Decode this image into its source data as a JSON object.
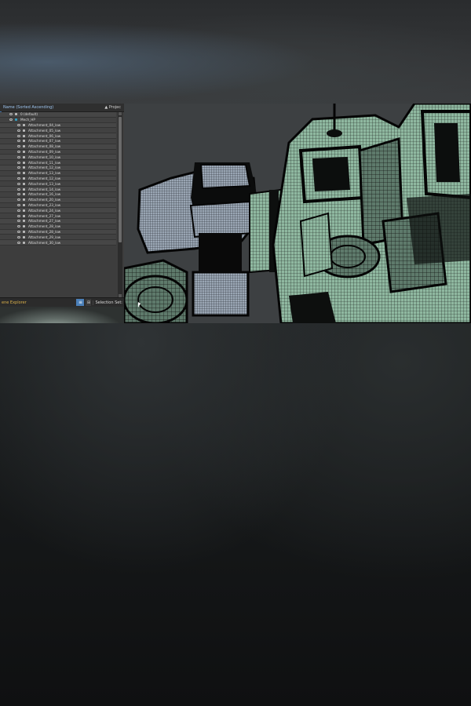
{
  "explorer": {
    "header_title": "Name (Sorted Ascending)",
    "header_project": "▲ Projec",
    "layer_default": "0 (default)",
    "group_name": "Mech_HP",
    "items": [
      "Attachment_04_low",
      "Attachment_05_low",
      "Attachment_06_low",
      "Attachment_07_low",
      "Attachment_08_low",
      "Attachment_09_low",
      "Attachment_10_low",
      "Attachment_11_low",
      "Attachment_12_low",
      "Attachment_13_low",
      "Attachment_12_low",
      "Attachment_13_low",
      "Attachment_14_low",
      "Attachment_16_low",
      "Attachment_20_low",
      "Attachment_23_low",
      "Attachment_24_low",
      "Attachment_27_low",
      "Attachment_27_low",
      "Attachment_28_low",
      "Attachment_28_low",
      "Attachment_29_low",
      "Attachment_30_low"
    ],
    "footer_label": "ene Explorer",
    "selection_set": "Selection Set:"
  },
  "colors": {
    "panel_bg": "#3d3d3d",
    "mesh_fill": "#8fb8a0",
    "mesh_wire": "#1a1f1c",
    "accent_blue": "#4a7fb8",
    "footer_label_color": "#d9b04a"
  },
  "icons": {
    "visibility": "eye-icon",
    "object": "object-icon",
    "layer": "layer-icon"
  }
}
